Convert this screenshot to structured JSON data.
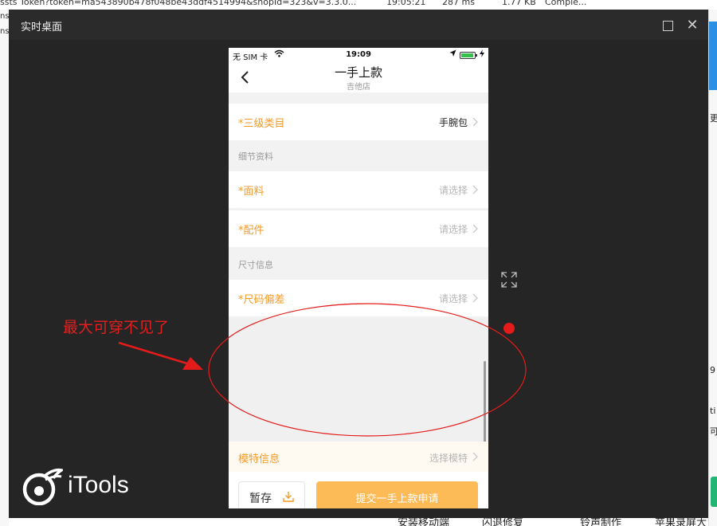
{
  "background": {
    "top_items": [
      "ssts Token?token=ma543890b478f048be43ddf4514994&shopId=323&v=3.3.0...",
      "19:05:21",
      "287 ms",
      "1.77 KB",
      "Comple..."
    ],
    "left_items": [
      "ns",
      "ns"
    ],
    "right_items": [
      "更",
      "9",
      "ti",
      "可"
    ],
    "bottom_items": [
      "安装移动端",
      "闪退修复",
      "铃声制作",
      "苹果录屏大师"
    ]
  },
  "window": {
    "title": "实时桌面",
    "maximize_icon": "maximize-icon",
    "close_label": "✕"
  },
  "phone": {
    "status_bar": {
      "carrier": "无 SIM 卡",
      "time": "19:09"
    },
    "nav": {
      "title": "一手上款",
      "subtitle": "吉他店"
    },
    "rows": {
      "level3_category": {
        "label": "*三级类目",
        "value": "手腕包"
      },
      "fabric": {
        "label": "*面料",
        "value": "请选择"
      },
      "accessories": {
        "label": "*配件",
        "value": "请选择"
      },
      "size_deviation": {
        "label": "*尺码偏差",
        "value": "请选择"
      }
    },
    "sections": {
      "detail": "细节资料",
      "size": "尺寸信息"
    },
    "model_row": {
      "label": "模特信息",
      "value": "选择模特"
    },
    "bottom": {
      "save_label": "暂存",
      "submit_label": "提交一手上款申请"
    }
  },
  "annotation": {
    "text": "最大可穿不见了",
    "color": "#e0201f"
  },
  "brand": {
    "name": "iTools"
  },
  "colors": {
    "accent_orange": "#f29b27",
    "submit_button": "#fdbb57",
    "window_bg": "#252525"
  }
}
